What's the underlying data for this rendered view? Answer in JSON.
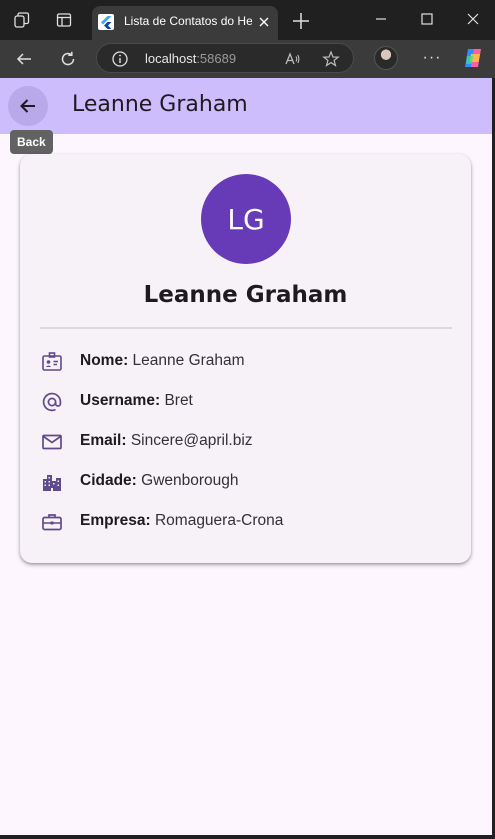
{
  "browser": {
    "tab_title": "Lista de Contatos do Hel",
    "address_host": "localhost",
    "address_port": ":58689"
  },
  "app": {
    "title": "Leanne Graham",
    "back_tooltip": "Back"
  },
  "contact": {
    "initials": "LG",
    "name": "Leanne Graham",
    "fields": [
      {
        "label": "Nome:",
        "value": "Leanne Graham",
        "icon": "badge-icon"
      },
      {
        "label": "Username:",
        "value": "Bret",
        "icon": "at-sign-icon"
      },
      {
        "label": "Email:",
        "value": "Sincere@april.biz",
        "icon": "mail-icon"
      },
      {
        "label": "Cidade:",
        "value": "Gwenborough",
        "icon": "city-icon"
      },
      {
        "label": "Empresa:",
        "value": "Romaguera-Crona",
        "icon": "briefcase-icon"
      }
    ]
  },
  "colors": {
    "appbar": "#cdbdfc",
    "avatar": "#673ab7",
    "icon": "#5e4b8b",
    "background": "#fdf6fe"
  }
}
